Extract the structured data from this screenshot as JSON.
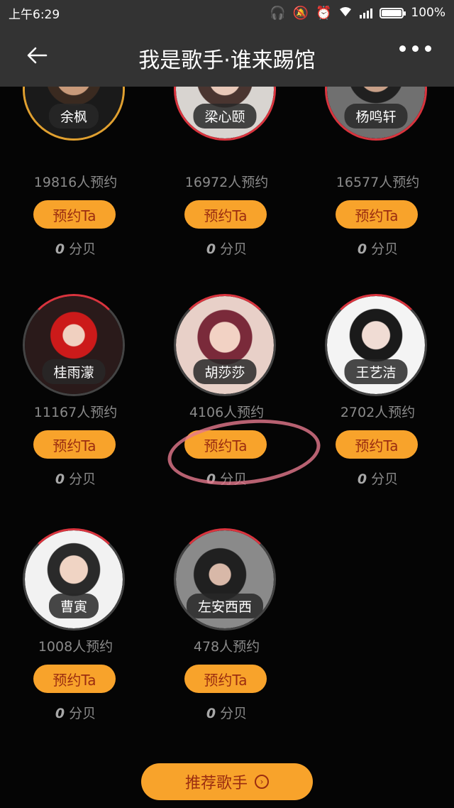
{
  "status_bar": {
    "time": "上午6:29",
    "battery": "100%"
  },
  "nav": {
    "title": "我是歌手·谁来踢馆"
  },
  "book_label": "预约Ta",
  "score_unit": "分贝",
  "singers": [
    {
      "name": "余枫",
      "bookings": "19816人预约",
      "score": "0"
    },
    {
      "name": "梁心颐",
      "bookings": "16972人预约",
      "score": "0"
    },
    {
      "name": "杨鸣轩",
      "bookings": "16577人预约",
      "score": "0"
    },
    {
      "name": "桂雨濛",
      "bookings": "11167人预约",
      "score": "0"
    },
    {
      "name": "胡莎莎",
      "bookings": "4106人预约",
      "score": "0"
    },
    {
      "name": "王艺洁",
      "bookings": "2702人预约",
      "score": "0"
    },
    {
      "name": "曹寅",
      "bookings": "1008人预约",
      "score": "0"
    },
    {
      "name": "左安西西",
      "bookings": "478人预约",
      "score": "0"
    }
  ],
  "recommend_button": {
    "label": "推荐歌手"
  },
  "colors": {
    "accent": "#f8a32b",
    "ring": "#d9343e",
    "button_text": "#9b2d10",
    "bar": "#333333"
  }
}
